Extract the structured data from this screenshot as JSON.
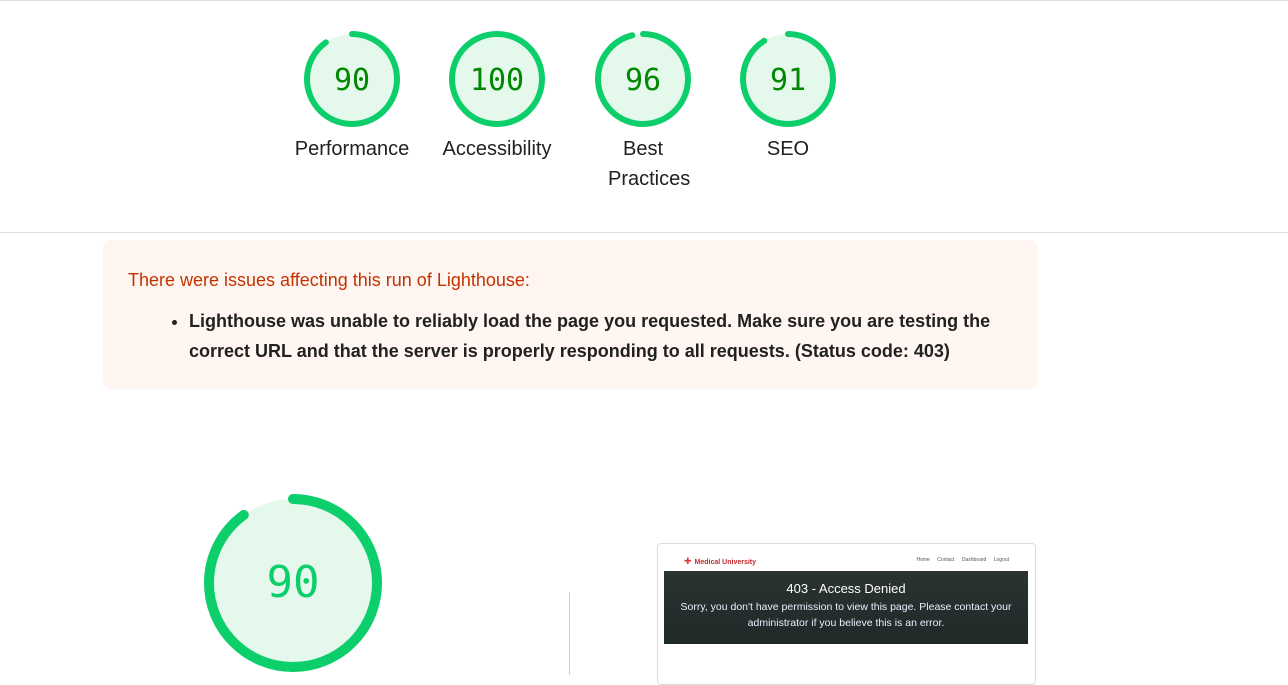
{
  "colors": {
    "pass": "#0cce6b",
    "pass_text": "#008800",
    "pass_fill": "#e5f8ec",
    "warning_text": "#c33300",
    "warning_bg": "#fff6f2"
  },
  "categories": [
    {
      "label": "Performance",
      "score": 90
    },
    {
      "label": "Accessibility",
      "score": 100
    },
    {
      "label": "Best Practices",
      "score": 96
    },
    {
      "label": "SEO",
      "score": 91
    }
  ],
  "warning": {
    "title": "There were issues affecting this run of Lighthouse:",
    "items": [
      "Lighthouse was unable to reliably load the page you requested. Make sure you are testing the correct URL and that the server is properly responding to all requests. (Status code: 403)"
    ]
  },
  "performance": {
    "score": 90
  },
  "screenshot": {
    "brand": "Medical University",
    "nav_links": [
      "Home",
      "Contact",
      "Dashboard",
      "Logout"
    ],
    "heading": "403 - Access Denied",
    "message": "Sorry, you don't have permission to view this page. Please contact your administrator if you believe this is an error."
  }
}
